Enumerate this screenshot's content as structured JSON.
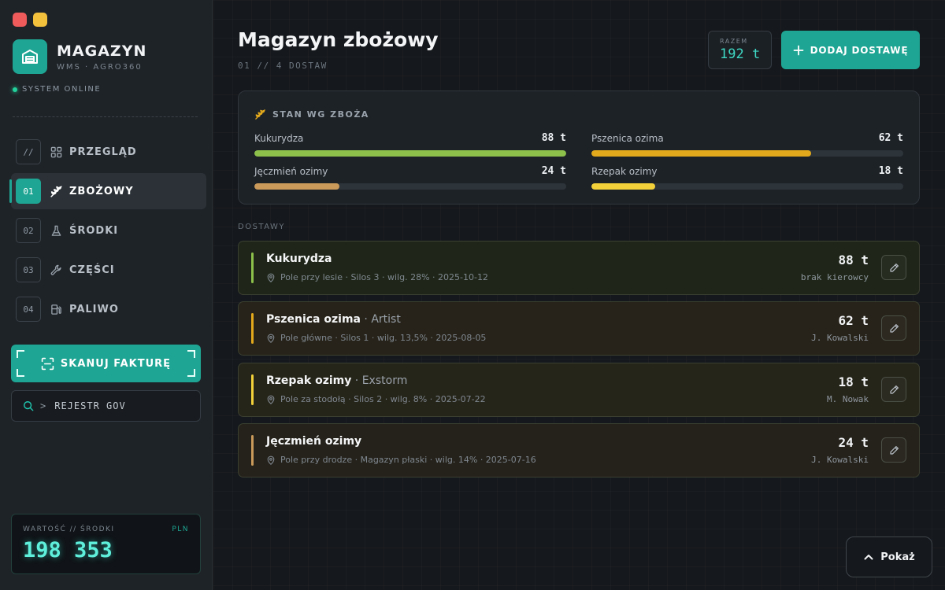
{
  "app": {
    "title": "MAGAZYN",
    "subtitle": "WMS · AGRO360",
    "status": "SYSTEM ONLINE"
  },
  "nav": {
    "items": [
      {
        "num": "//",
        "label": "PRZEGLĄD",
        "icon": "grid-icon"
      },
      {
        "num": "01",
        "label": "ZBOŻOWY",
        "icon": "wheat-icon",
        "active": true
      },
      {
        "num": "02",
        "label": "ŚRODKI",
        "icon": "flask-icon"
      },
      {
        "num": "03",
        "label": "CZĘŚCI",
        "icon": "wrench-icon"
      },
      {
        "num": "04",
        "label": "PALIWO",
        "icon": "fuel-icon"
      }
    ]
  },
  "actions": {
    "scan_label": "SKANUJ FAKTURĘ",
    "registry_prompt": ">",
    "registry_label": "REJESTR GOV"
  },
  "value_card": {
    "label": "WARTOŚĆ // ŚRODKI",
    "currency": "PLN",
    "value": "198 353"
  },
  "header": {
    "title": "Magazyn zbożowy",
    "subtitle": "01 // 4 DOSTAW",
    "total_label": "RAZEM",
    "total_value": "192 t",
    "add_label": "DODAJ DOSTAWĘ"
  },
  "stock": {
    "title": "STAN WG ZBOŻA",
    "max": 88,
    "items": [
      {
        "name": "Kukurydza",
        "value": 88,
        "display": "88 t",
        "color": "#8cc04b"
      },
      {
        "name": "Pszenica ozima",
        "value": 62,
        "display": "62 t",
        "color": "#e2a91c"
      },
      {
        "name": "Jęczmień ozimy",
        "value": 24,
        "display": "24 t",
        "color": "#c99a5a"
      },
      {
        "name": "Rzepak ozimy",
        "value": 18,
        "display": "18 t",
        "color": "#f2d13a"
      }
    ]
  },
  "deliveries": {
    "section_label": "DOSTAWY",
    "items": [
      {
        "name": "Kukurydza",
        "variety": "",
        "meta": "Pole przy lesie · Silos 3 · wilg. 28% · 2025-10-12",
        "qty": "88 t",
        "driver": "brak kierowcy",
        "accent": "#8cc04b",
        "bg": "#1f2619"
      },
      {
        "name": "Pszenica ozima",
        "variety": " · Artist",
        "meta": "Pole główne · Silos 1 · wilg. 13,5% · 2025-08-05",
        "qty": "62 t",
        "driver": "J. Kowalski",
        "accent": "#e2a91c",
        "bg": "#27231a"
      },
      {
        "name": "Rzepak ozimy",
        "variety": " · Exstorm",
        "meta": "Pole za stodołą · Silos 2 · wilg. 8% · 2025-07-22",
        "qty": "18 t",
        "driver": "M. Nowak",
        "accent": "#f2d13a",
        "bg": "#26251a"
      },
      {
        "name": "Jęczmień ozimy",
        "variety": "",
        "meta": "Pole przy drodze · Magazyn płaski · wilg. 14% · 2025-07-16",
        "qty": "24 t",
        "driver": "J. Kowalski",
        "accent": "#c99a5a",
        "bg": "#25221b"
      }
    ]
  },
  "footer": {
    "show_label": "Pokaż"
  },
  "colors": {
    "accent": "#1fa593",
    "glow": "#5ff0dc"
  }
}
